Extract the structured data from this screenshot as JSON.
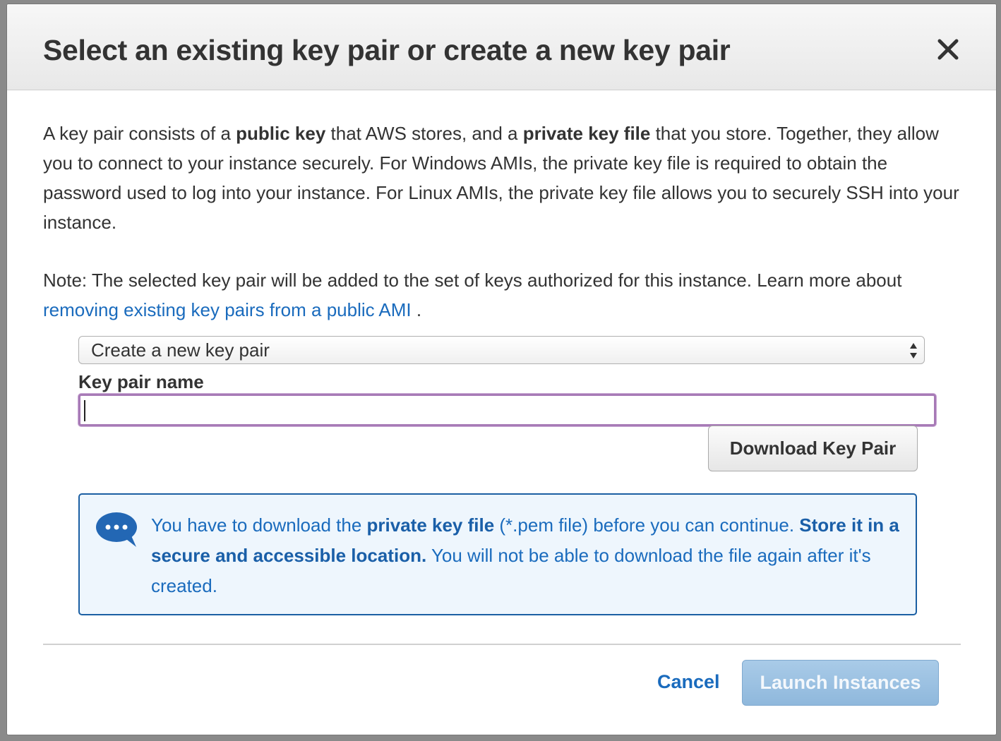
{
  "modal": {
    "title": "Select an existing key pair or create a new key pair",
    "close_icon": "close-icon"
  },
  "description": {
    "part1": "A key pair consists of a ",
    "bold1": "public key",
    "part2": " that AWS stores, and a ",
    "bold2": "private key file",
    "part3": " that you store. Together, they allow you to connect to your instance securely. For Windows AMIs, the private key file is required to obtain the password used to log into your instance. For Linux AMIs, the private key file allows you to securely SSH into your instance."
  },
  "note": {
    "text": "Note: The selected key pair will be added to the set of keys authorized for this instance. Learn more about ",
    "link": "removing existing key pairs from a public AMI",
    "end": " ."
  },
  "key_pair_select": {
    "selected": "Create a new key pair"
  },
  "key_pair_name": {
    "label": "Key pair name",
    "value": ""
  },
  "download_button": "Download Key Pair",
  "info": {
    "icon": "chat-bubble-icon",
    "part1": "You have to download the ",
    "bold1": "private key file",
    "part2": " (*.pem file) before you can continue. ",
    "bold2": "Store it in a secure and accessible location.",
    "part3": " You will not be able to download the file again after it's created."
  },
  "footer": {
    "cancel": "Cancel",
    "launch": "Launch Instances"
  },
  "colors": {
    "link": "#1a6bbd",
    "info_border": "#1b5fa3",
    "info_bg": "#eef6fd",
    "input_focus": "#a77ab6",
    "launch_disabled": "#9ec3e3"
  }
}
